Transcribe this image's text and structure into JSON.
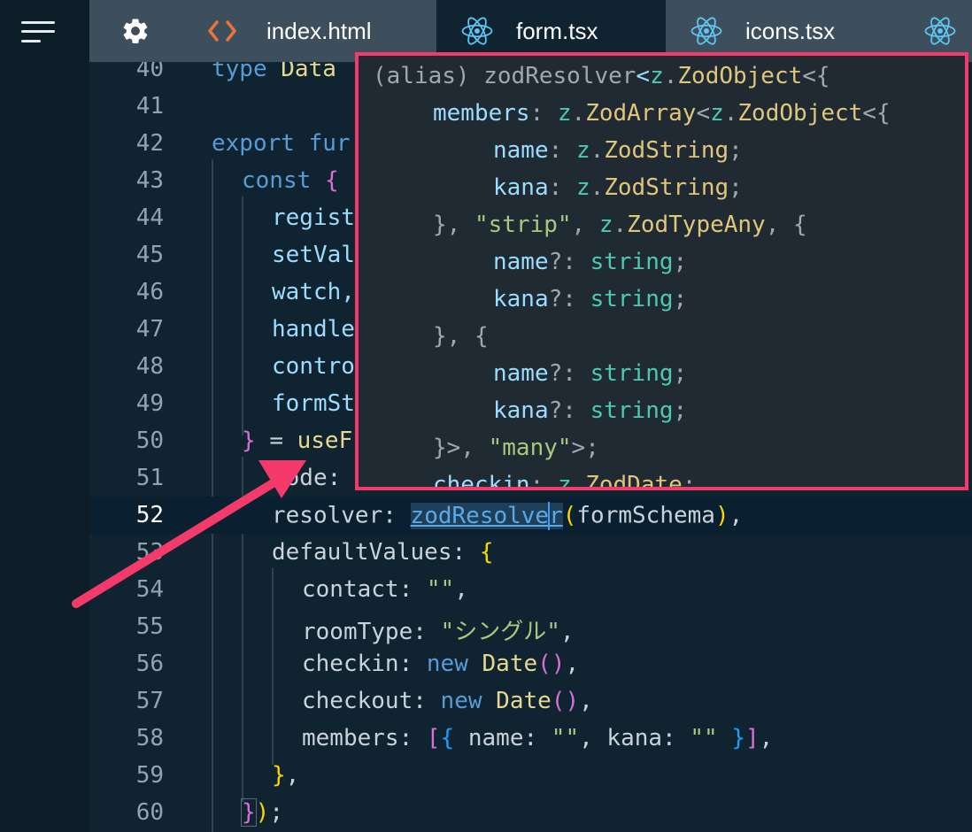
{
  "tabs": [
    {
      "label": "index.html",
      "icon": "html-brackets-icon",
      "active": false
    },
    {
      "label": "form.tsx",
      "icon": "react-icon",
      "active": true
    },
    {
      "label": "icons.tsx",
      "icon": "react-icon",
      "active": false
    }
  ],
  "editor": {
    "current_line": "52",
    "lines": [
      {
        "num": "40",
        "code": "type Data"
      },
      {
        "num": "41",
        "code": ""
      },
      {
        "num": "42",
        "code": "export fur"
      },
      {
        "num": "43",
        "code": "const {"
      },
      {
        "num": "44",
        "code": "regist"
      },
      {
        "num": "45",
        "code": "setVal"
      },
      {
        "num": "46",
        "code": "watch,"
      },
      {
        "num": "47",
        "code": "handle"
      },
      {
        "num": "48",
        "code": "contro"
      },
      {
        "num": "49",
        "code": "formSt"
      },
      {
        "num": "50",
        "code": "} = useF"
      },
      {
        "num": "51",
        "code": "mode:"
      },
      {
        "num": "52",
        "code": "resolver: zodResolver(formSchema),"
      },
      {
        "num": "53",
        "code": "defaultValues: {"
      },
      {
        "num": "54",
        "code": "contact: \"\","
      },
      {
        "num": "55",
        "code": "roomType: \"シングル\","
      },
      {
        "num": "56",
        "code": "checkin: new Date(),"
      },
      {
        "num": "57",
        "code": "checkout: new Date(),"
      },
      {
        "num": "58",
        "code": "members: [{ name: \"\", kana: \"\" }],"
      },
      {
        "num": "59",
        "code": "},"
      },
      {
        "num": "60",
        "code": "});"
      }
    ]
  },
  "hover": {
    "lines": [
      "(alias) zodResolver<z.ZodObject<{",
      "members: z.ZodArray<z.ZodObject<{",
      "name: z.ZodString;",
      "kana: z.ZodString;",
      "}, \"strip\", z.ZodTypeAny, {",
      "name?: string;",
      "kana?: string;",
      "}, {",
      "name?: string;",
      "kana?: string;",
      "}>, \"many\">;",
      "checkin: z.ZodDate;"
    ]
  },
  "colors": {
    "background": "#0f2330",
    "tabbar": "#3d4f5c",
    "highlight_border": "#f43a6a",
    "arrow": "#f43a6a"
  }
}
